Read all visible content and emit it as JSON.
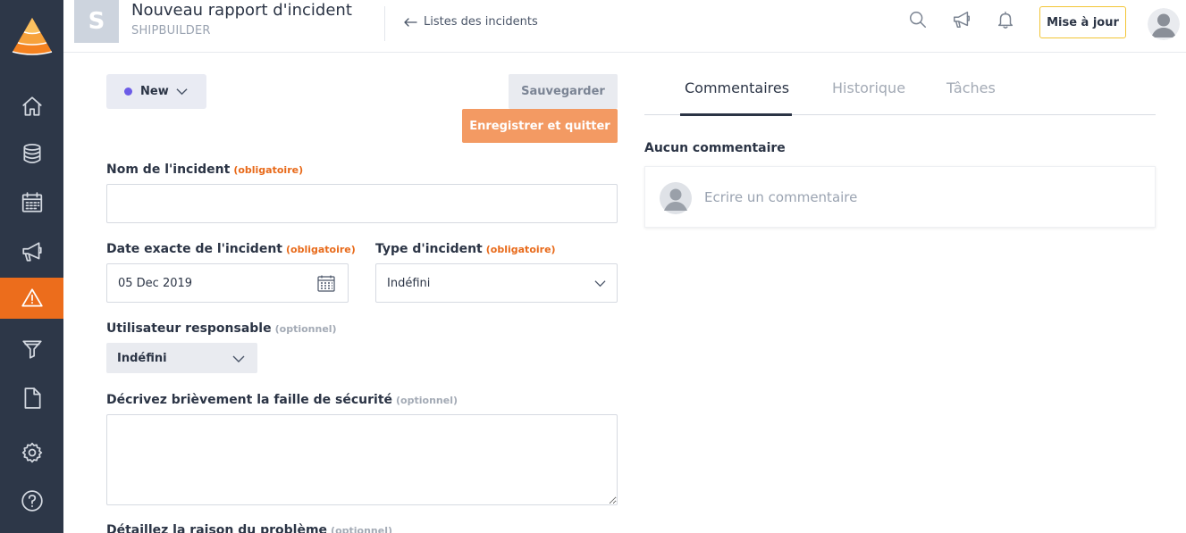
{
  "page": {
    "title": "Nouveau rapport d'incident",
    "company": "SHIPBUILDER",
    "back_link": "Listes des incidents",
    "tile_letter": "S",
    "update_button": "Mise à jour"
  },
  "sidebar": {
    "items": [
      {
        "name": "home",
        "icon": "home-icon"
      },
      {
        "name": "database",
        "icon": "database-icon"
      },
      {
        "name": "calendar",
        "icon": "calendar-icon"
      },
      {
        "name": "announcements",
        "icon": "megaphone-icon"
      },
      {
        "name": "incidents",
        "icon": "warning-icon",
        "active": true
      },
      {
        "name": "filter",
        "icon": "filter-icon"
      },
      {
        "name": "documents",
        "icon": "document-icon"
      },
      {
        "name": "settings",
        "icon": "gear-icon"
      },
      {
        "name": "help",
        "icon": "help-icon"
      }
    ]
  },
  "toolbar": {
    "status_label": "New",
    "status_color": "#6c5ce7",
    "save_label": "Sauvegarder",
    "save_quit_label": "Enregistrer et quitter"
  },
  "form": {
    "required_tag": "(obligatoire)",
    "optional_tag": "(optionnel)",
    "incident_name": {
      "label": "Nom de l'incident",
      "value": ""
    },
    "incident_date": {
      "label": "Date exacte de l'incident",
      "value": "05 Dec 2019"
    },
    "incident_type": {
      "label": "Type d'incident",
      "value": "Indéfini"
    },
    "responsible_user": {
      "label": "Utilisateur responsable",
      "value": "Indéfini"
    },
    "security_flaw": {
      "label": "Décrivez brièvement la faille de sécurité",
      "value": ""
    },
    "problem_reason": {
      "label": "Détaillez la raison du problème"
    }
  },
  "panel": {
    "tabs": [
      "Commentaires",
      "Historique",
      "Tâches"
    ],
    "active_tab": "Commentaires",
    "no_comments": "Aucun commentaire",
    "comment_placeholder": "Ecrire un commentaire"
  },
  "colors": {
    "sidebar_bg": "#2d3748",
    "accent": "#ec6d1c",
    "save_quit_bg": "#f39a63"
  }
}
